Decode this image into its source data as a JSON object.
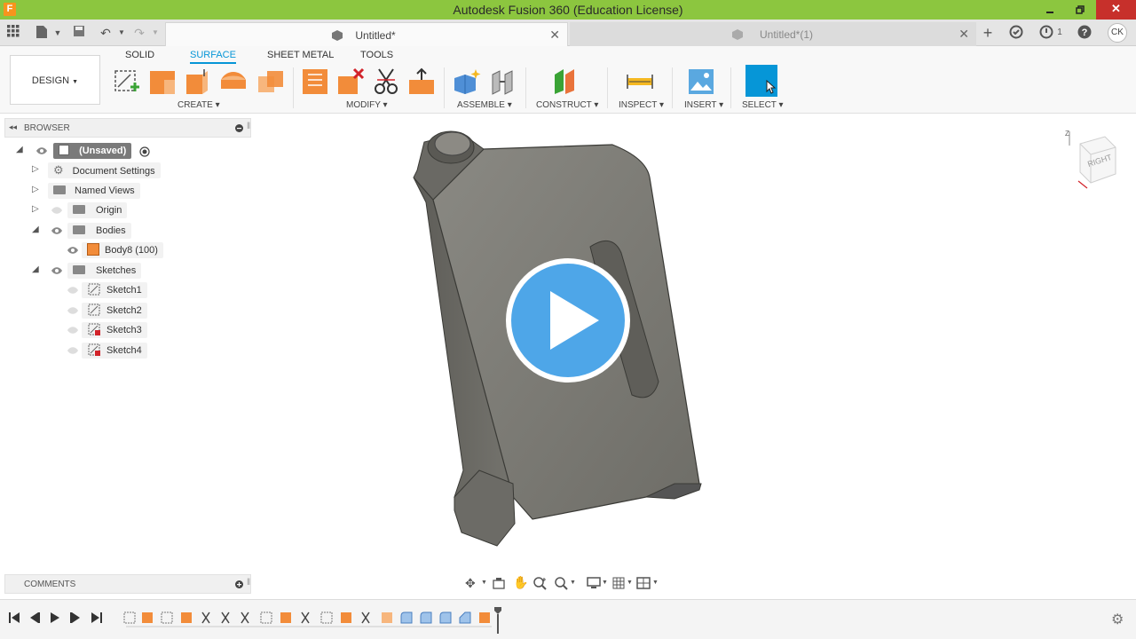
{
  "window": {
    "app_icon_letter": "F",
    "title": "Autodesk Fusion 360 (Education License)",
    "close_glyph": "✕"
  },
  "tabs": [
    {
      "label": "Untitled*",
      "active": true
    },
    {
      "label": "Untitled*(1)",
      "active": false
    }
  ],
  "topbar": {
    "notification_count": "1",
    "user_initials": "CK"
  },
  "toolbar": {
    "workspace": "DESIGN",
    "workspace_tabs": [
      "SOLID",
      "SURFACE",
      "SHEET METAL",
      "TOOLS"
    ],
    "active_tab": "SURFACE",
    "groups": [
      "CREATE",
      "MODIFY",
      "ASSEMBLE",
      "CONSTRUCT",
      "INSPECT",
      "INSERT",
      "SELECT"
    ]
  },
  "browser": {
    "header": "BROWSER",
    "root": "(Unsaved)",
    "items": [
      {
        "label": "Document Settings",
        "icon": "gear-icon"
      },
      {
        "label": "Named Views",
        "icon": "folder-icon"
      },
      {
        "label": "Origin",
        "icon": "folder-icon"
      },
      {
        "label": "Bodies",
        "icon": "folder-icon"
      },
      {
        "label": "Body8 (100)",
        "icon": "body-icon"
      },
      {
        "label": "Sketches",
        "icon": "folder-icon"
      },
      {
        "label": "Sketch1",
        "icon": "sketch-icon"
      },
      {
        "label": "Sketch2",
        "icon": "sketch-icon"
      },
      {
        "label": "Sketch3",
        "icon": "sketch-error-icon"
      },
      {
        "label": "Sketch4",
        "icon": "sketch-error-icon"
      }
    ]
  },
  "comments": {
    "header": "COMMENTS"
  },
  "viewcube": {
    "face_label": "RIGHT",
    "axis_label": "Z"
  },
  "colors": {
    "titlebar": "#8cc63f",
    "accent": "#0696d7",
    "play_button": "#4ea6e8",
    "model": "#7b7a74"
  }
}
